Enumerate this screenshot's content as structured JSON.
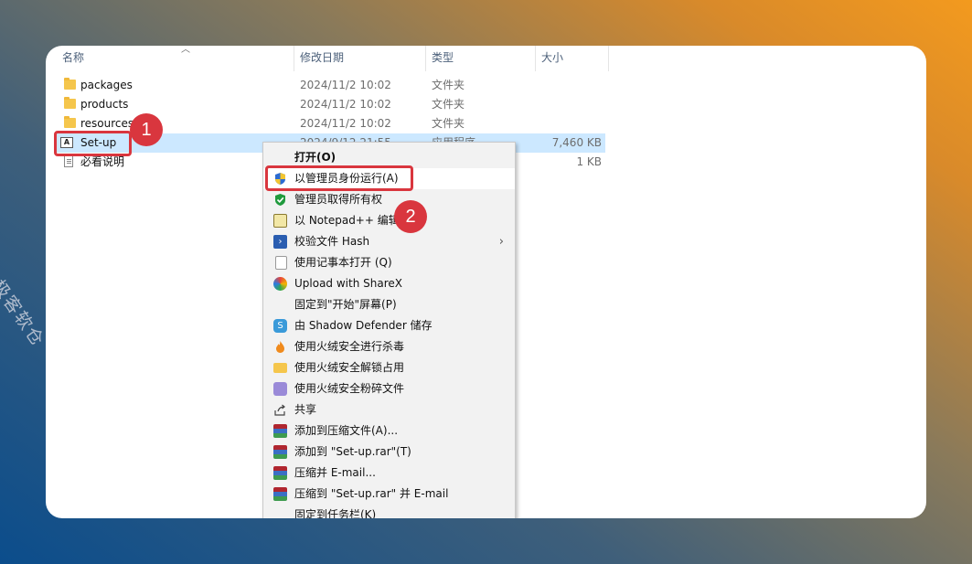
{
  "columns": {
    "name": "名称",
    "date": "修改日期",
    "type": "类型",
    "size": "大小"
  },
  "files": [
    {
      "name": "packages",
      "date": "2024/11/2 10:02",
      "type": "文件夹",
      "size": "",
      "icon": "folder-icon"
    },
    {
      "name": "products",
      "date": "2024/11/2 10:02",
      "type": "文件夹",
      "size": "",
      "icon": "folder-icon"
    },
    {
      "name": "resources",
      "date": "2024/11/2 10:02",
      "type": "文件夹",
      "size": "",
      "icon": "folder-icon"
    },
    {
      "name": "Set-up",
      "date": "2024/9/12 21:55",
      "type": "应用程序",
      "size": "7,460 KB",
      "icon": "adobe-app-icon"
    },
    {
      "name": "必看说明",
      "date": "",
      "type": "",
      "size": "1 KB",
      "icon": "text-file-icon"
    }
  ],
  "badges": {
    "one": "1",
    "two": "2"
  },
  "menu": [
    {
      "label": "打开(O)",
      "icon": "",
      "bold": true
    },
    {
      "label": "以管理员身份运行(A)",
      "icon": "uac-shield-icon"
    },
    {
      "label": "管理员取得所有权",
      "icon": "green-shield-icon"
    },
    {
      "label": "以 Notepad++ 编辑",
      "icon": "notepadpp-icon"
    },
    {
      "label": "校验文件 Hash",
      "icon": "powershell-icon",
      "submenu": true
    },
    {
      "label": "使用记事本打开 (Q)",
      "icon": "notepad-icon"
    },
    {
      "label": "Upload with ShareX",
      "icon": "sharex-icon"
    },
    {
      "label": "固定到\"开始\"屏幕(P)",
      "icon": ""
    },
    {
      "label": "由 Shadow Defender 储存",
      "icon": "shadow-defender-icon"
    },
    {
      "label": "使用火绒安全进行杀毒",
      "icon": "huorong-flame-icon"
    },
    {
      "label": "使用火绒安全解锁占用",
      "icon": "folder-unlock-icon"
    },
    {
      "label": "使用火绒安全粉碎文件",
      "icon": "shredder-icon"
    },
    {
      "label": "共享",
      "icon": "share-icon"
    },
    {
      "label": "添加到压缩文件(A)...",
      "icon": "winrar-icon"
    },
    {
      "label": "添加到 \"Set-up.rar\"(T)",
      "icon": "winrar-icon"
    },
    {
      "label": "压缩并 E-mail...",
      "icon": "winrar-icon"
    },
    {
      "label": "压缩到 \"Set-up.rar\" 并 E-mail",
      "icon": "winrar-icon"
    },
    {
      "label": "固定到任务栏(K)",
      "icon": ""
    }
  ],
  "watermark": "极客软仓"
}
